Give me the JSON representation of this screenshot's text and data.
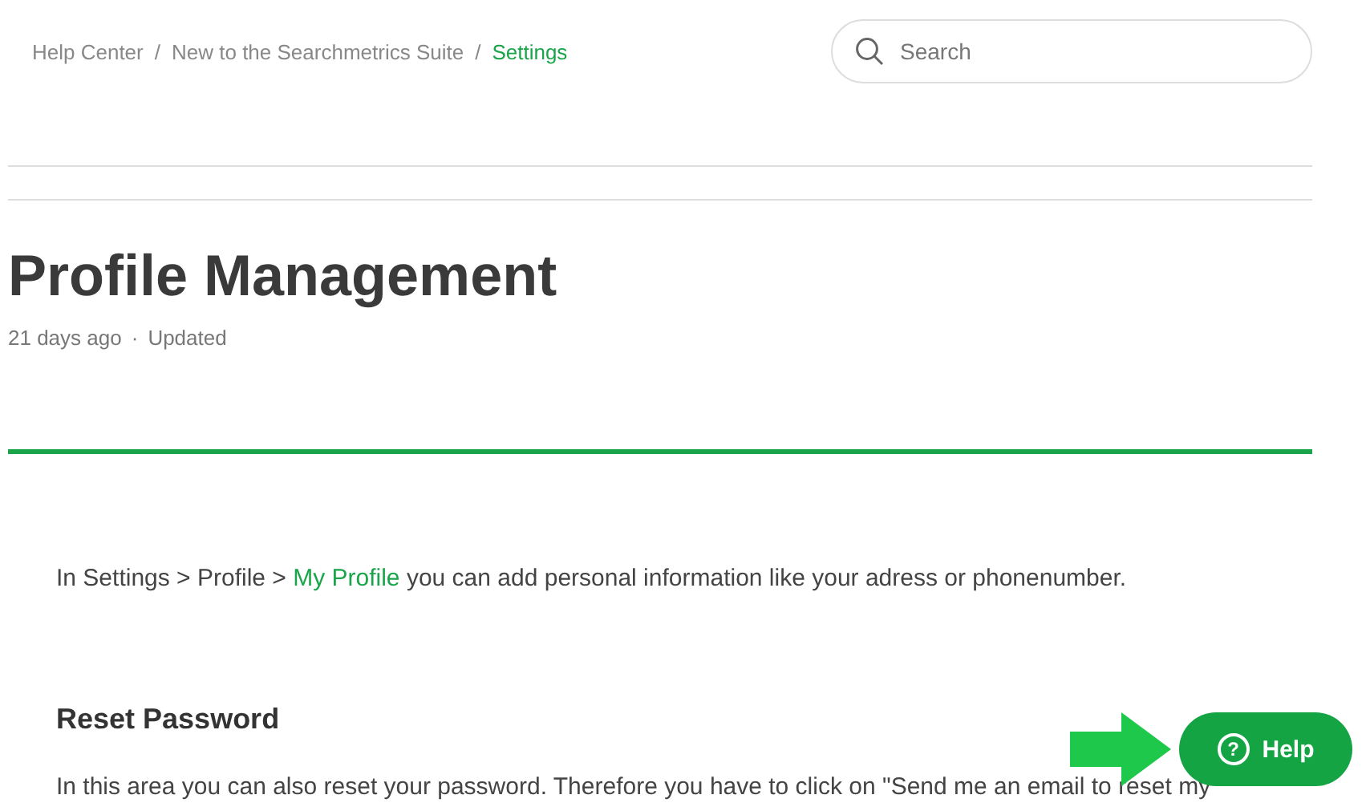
{
  "breadcrumbs": [
    {
      "label": "Help Center",
      "selected": false
    },
    {
      "label": "New to the Searchmetrics Suite",
      "selected": false
    },
    {
      "label": "Settings",
      "selected": true
    }
  ],
  "breadcrumb_separator": "/",
  "search": {
    "placeholder": "Search"
  },
  "meta_separator": "·",
  "article": {
    "title": "Profile Management",
    "age": "21 days ago",
    "status": "Updated",
    "intro": {
      "before": "In Settings > Profile > ",
      "link": "My Profile",
      "after": " you can add personal information like your adress or phonenumber."
    },
    "heading": "Reset Password",
    "paragraph": "In this area you can also reset your password. Therefore you have to click on \"Send me an email to reset my"
  },
  "help_button": {
    "label": "Help",
    "icon": "?"
  }
}
